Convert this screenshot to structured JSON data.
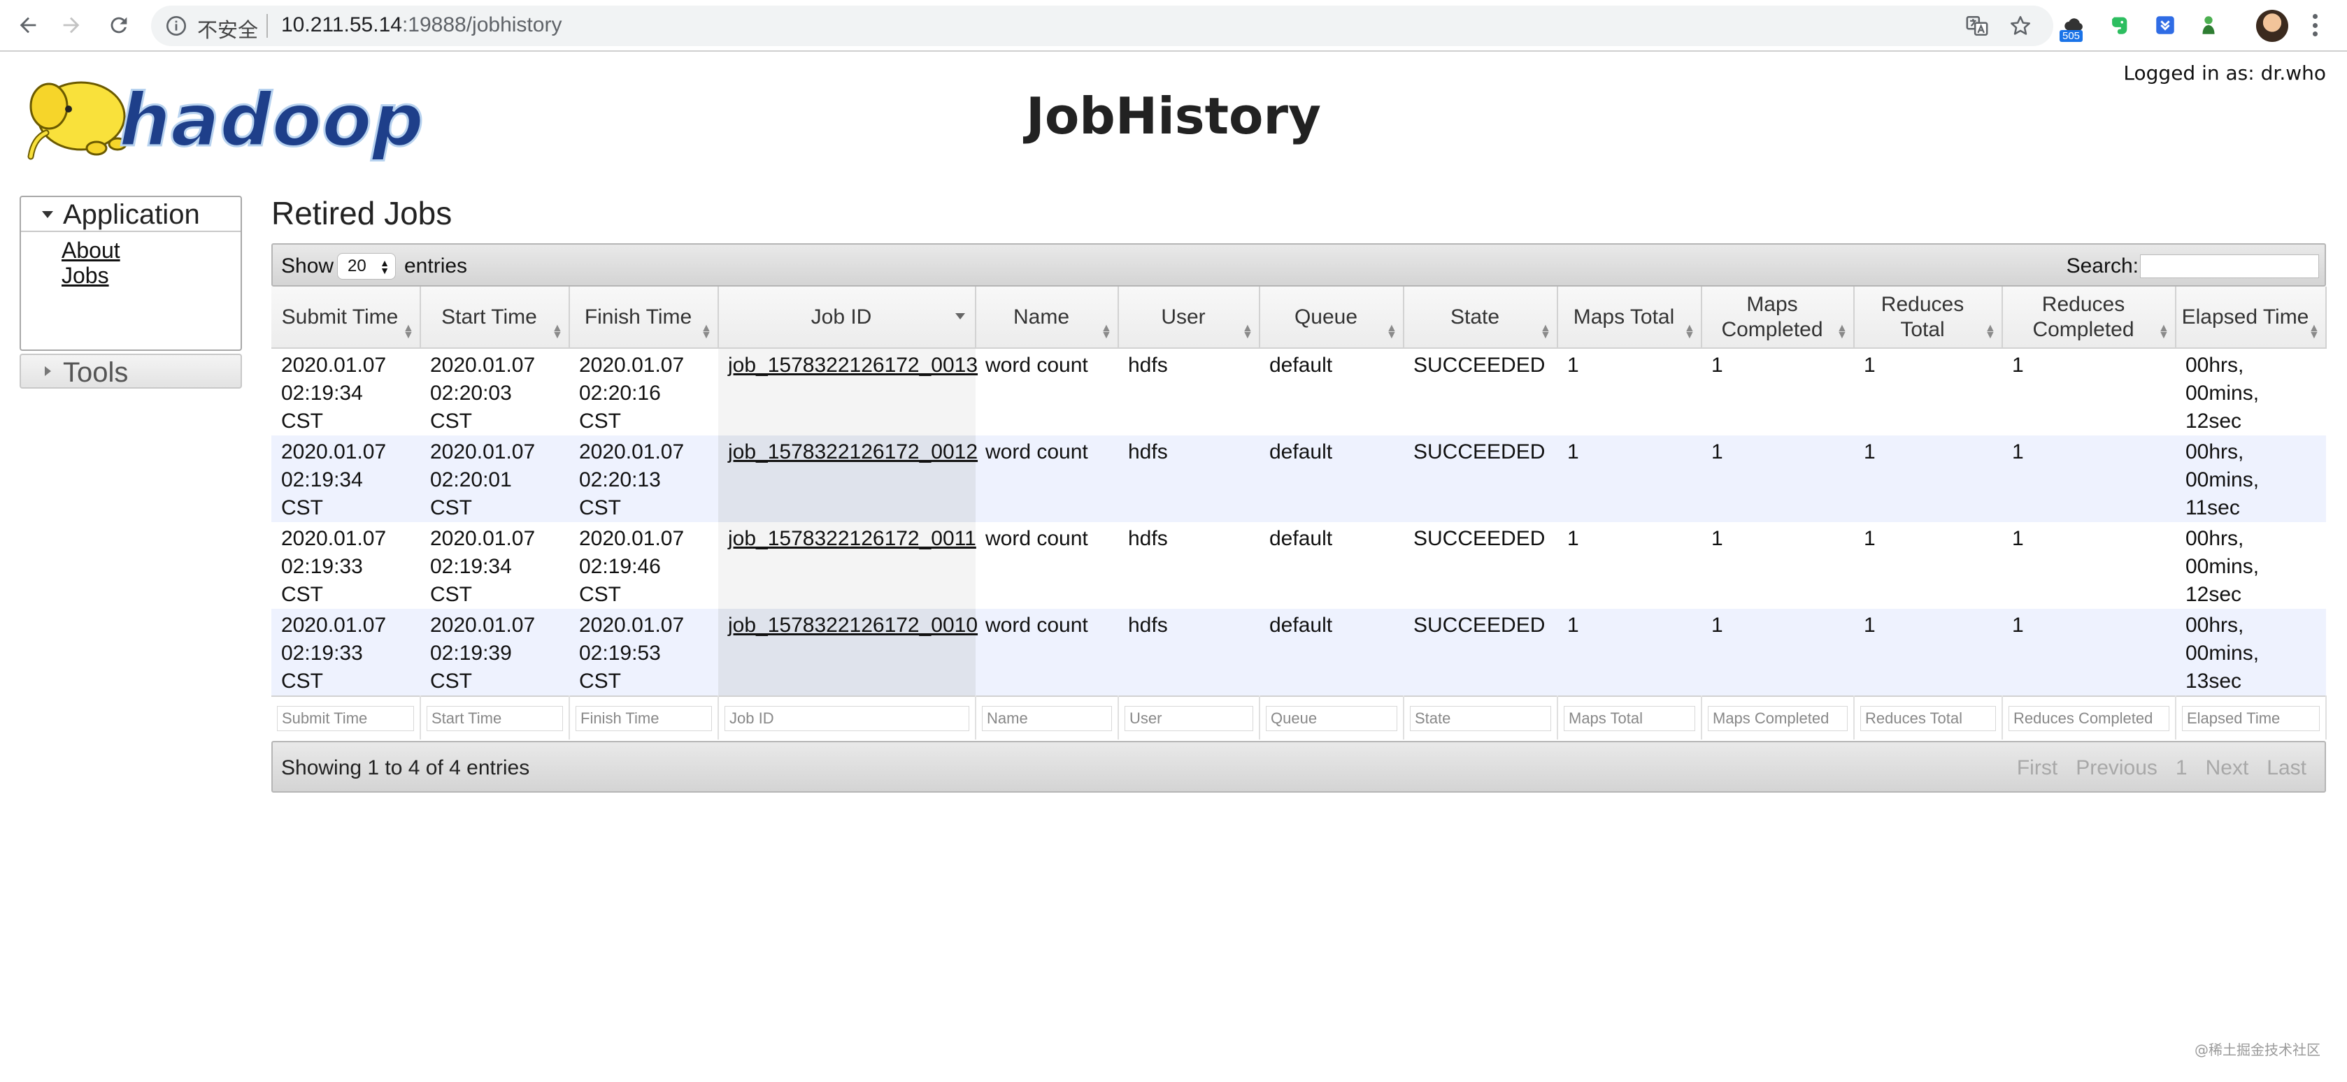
{
  "browser": {
    "security_label": "不安全",
    "url_host": "10.211.55.14",
    "url_rest": ":19888/jobhistory",
    "extension_badge": "505"
  },
  "header": {
    "title": "JobHistory",
    "logged_in": "Logged in as: dr.who",
    "logo_text": "hadoop"
  },
  "sidebar": {
    "application_label": "Application",
    "links": [
      "About",
      "Jobs"
    ],
    "tools_label": "Tools"
  },
  "main": {
    "section_title": "Retired Jobs",
    "show_label": "Show",
    "page_length": "20",
    "entries_label": "entries",
    "search_label": "Search:",
    "columns": [
      "Submit Time",
      "Start Time",
      "Finish Time",
      "Job ID",
      "Name",
      "User",
      "Queue",
      "State",
      "Maps Total",
      "Maps Completed",
      "Reduces Total",
      "Reduces Completed",
      "Elapsed Time"
    ],
    "rows": [
      [
        "2020.01.07 02:19:34 CST",
        "2020.01.07 02:20:03 CST",
        "2020.01.07 02:20:16 CST",
        "job_1578322126172_0013",
        "word count",
        "hdfs",
        "default",
        "SUCCEEDED",
        "1",
        "1",
        "1",
        "1",
        "00hrs, 00mins, 12sec"
      ],
      [
        "2020.01.07 02:19:34 CST",
        "2020.01.07 02:20:01 CST",
        "2020.01.07 02:20:13 CST",
        "job_1578322126172_0012",
        "word count",
        "hdfs",
        "default",
        "SUCCEEDED",
        "1",
        "1",
        "1",
        "1",
        "00hrs, 00mins, 11sec"
      ],
      [
        "2020.01.07 02:19:33 CST",
        "2020.01.07 02:19:34 CST",
        "2020.01.07 02:19:46 CST",
        "job_1578322126172_0011",
        "word count",
        "hdfs",
        "default",
        "SUCCEEDED",
        "1",
        "1",
        "1",
        "1",
        "00hrs, 00mins, 12sec"
      ],
      [
        "2020.01.07 02:19:33 CST",
        "2020.01.07 02:19:39 CST",
        "2020.01.07 02:19:53 CST",
        "job_1578322126172_0010",
        "word count",
        "hdfs",
        "default",
        "SUCCEEDED",
        "1",
        "1",
        "1",
        "1",
        "00hrs, 00mins, 13sec"
      ]
    ],
    "filter_placeholders": [
      "Submit Time",
      "Start Time",
      "Finish Time",
      "Job ID",
      "Name",
      "User",
      "Queue",
      "State",
      "Maps Total",
      "Maps Completed",
      "Reduces Total",
      "Reduces Completed",
      "Elapsed Time"
    ],
    "info": "Showing 1 to 4 of 4 entries",
    "pagination": [
      "First",
      "Previous",
      "1",
      "Next",
      "Last"
    ]
  },
  "watermark": "@稀土掘金技术社区"
}
